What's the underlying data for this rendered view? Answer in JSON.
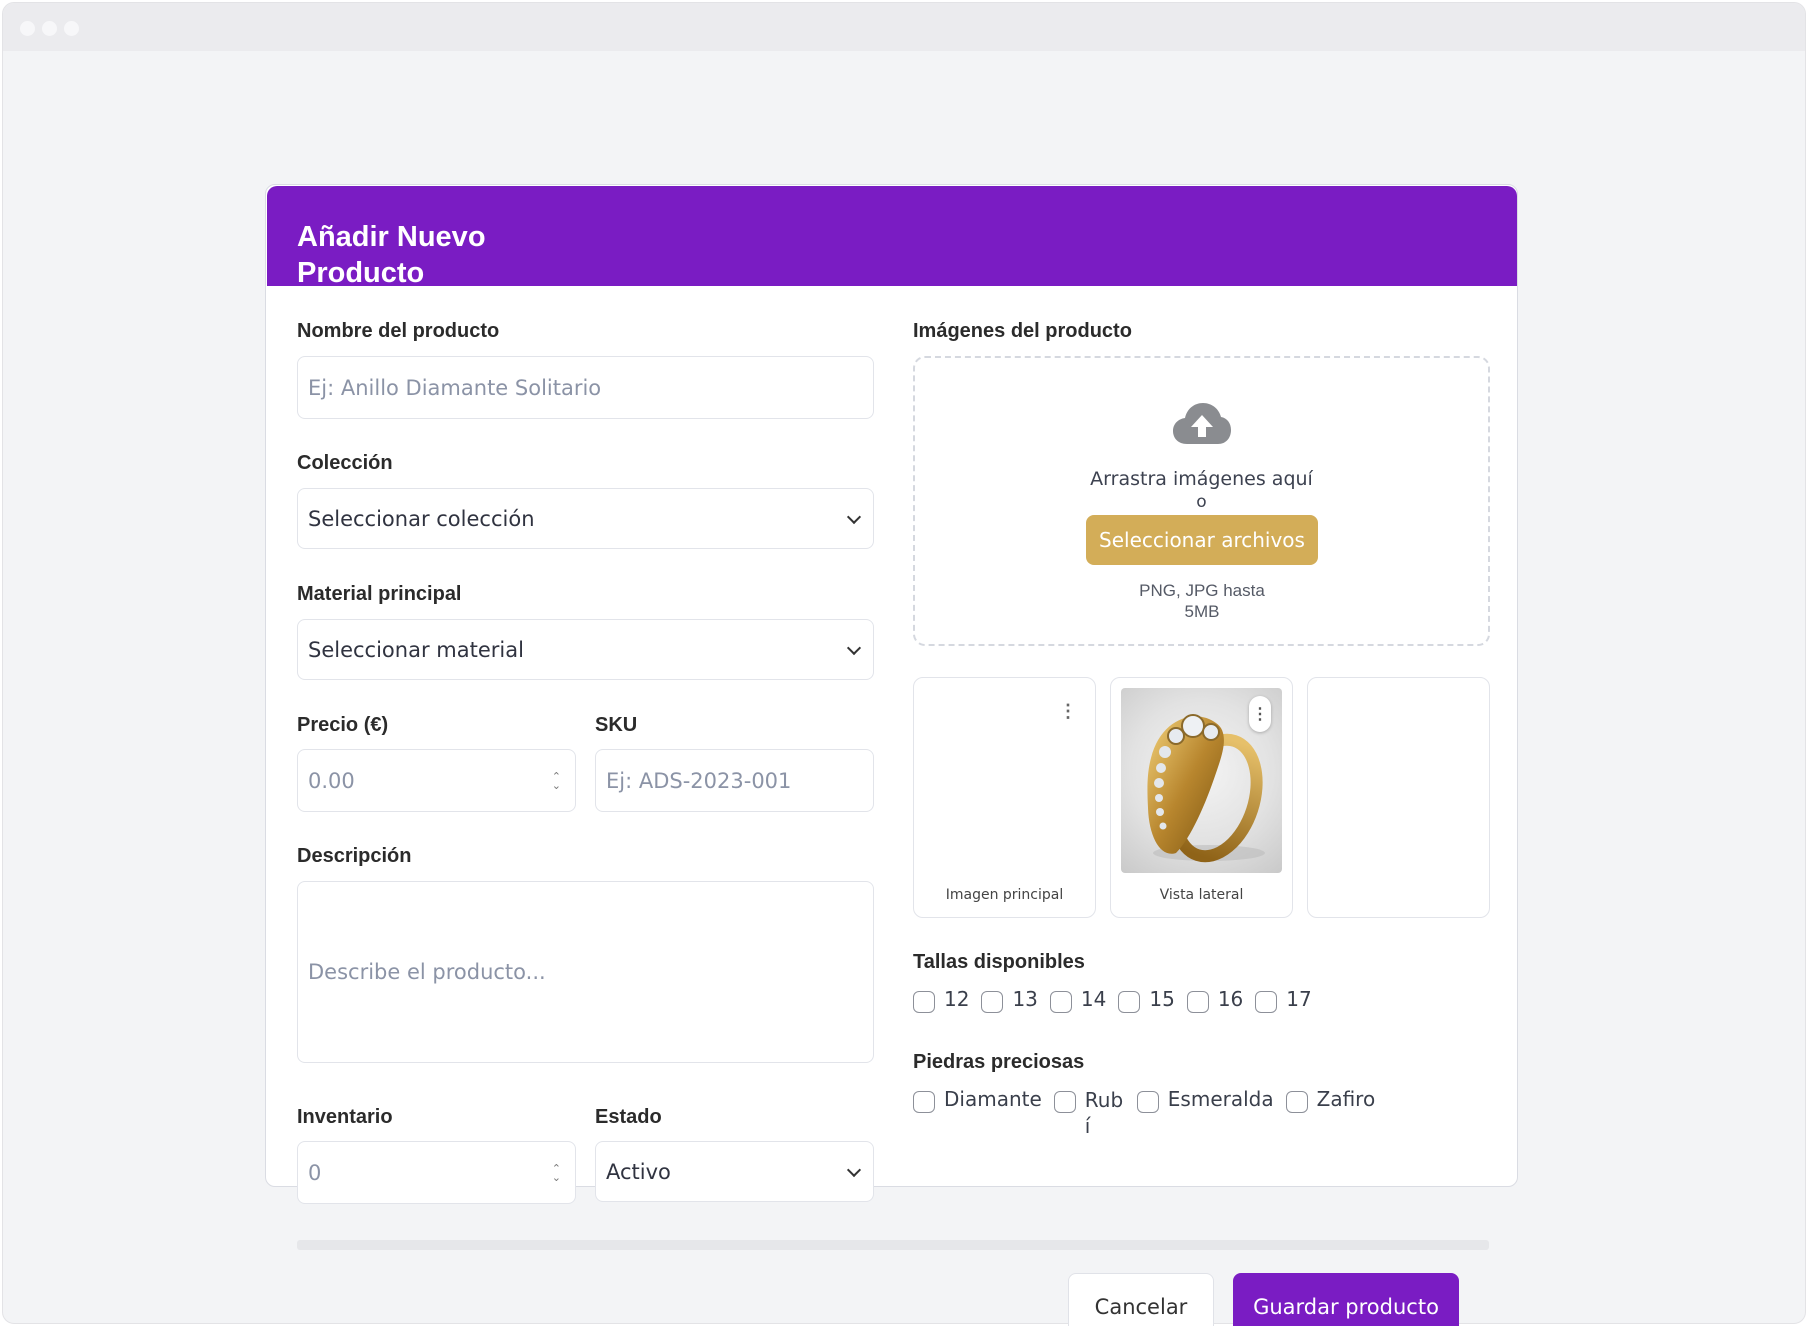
{
  "window": {
    "controls": [
      "close",
      "minimize",
      "maximize"
    ]
  },
  "header": {
    "title": "Añadir Nuevo Producto"
  },
  "form": {
    "name": {
      "label": "Nombre del producto",
      "placeholder": "Ej: Anillo Diamante Solitario"
    },
    "collection": {
      "label": "Colección",
      "value": "Seleccionar colección"
    },
    "material": {
      "label": "Material principal",
      "value": "Seleccionar material"
    },
    "price": {
      "label": "Precio (€)",
      "placeholder": "0.00"
    },
    "sku": {
      "label": "SKU",
      "placeholder": "Ej: ADS-2023-001"
    },
    "description": {
      "label": "Descripción",
      "placeholder": "Describe el producto..."
    },
    "inventory": {
      "label": "Inventario",
      "placeholder": "0"
    },
    "status": {
      "label": "Estado",
      "value": "Activo"
    }
  },
  "images": {
    "label": "Imágenes del producto",
    "upload_icon": "cloud-upload-icon",
    "drag_text": "Arrastra imágenes aquí",
    "or_text": "o",
    "select_button": "Seleccionar archivos",
    "hint": "PNG, JPG hasta 5MB",
    "thumbnails": [
      {
        "caption": "Imagen principal",
        "has_image": false
      },
      {
        "caption": "Vista lateral",
        "has_image": true,
        "image": "gold-diamond-ring"
      },
      {
        "caption": "",
        "has_image": false
      }
    ]
  },
  "sizes": {
    "label": "Tallas disponibles",
    "options": [
      "12",
      "13",
      "14",
      "15",
      "16",
      "17"
    ]
  },
  "stones": {
    "label": "Piedras preciosas",
    "options": [
      "Diamante",
      "Rubí",
      "Esmeralda",
      "Zafiro"
    ]
  },
  "actions": {
    "cancel": "Cancelar",
    "save": "Guardar producto"
  },
  "colors": {
    "primary": "#7a1cc3",
    "gold": "#d3ad58"
  }
}
